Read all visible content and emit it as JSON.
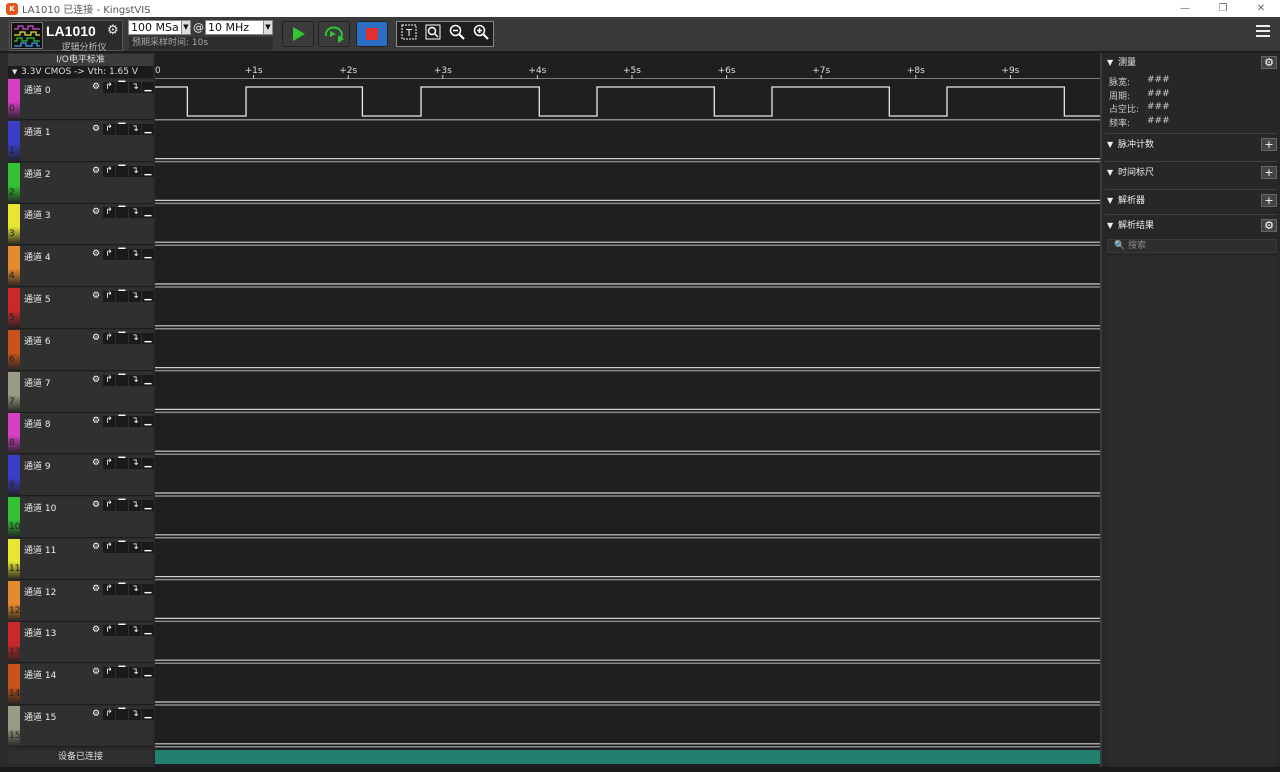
{
  "window": {
    "title": "LA1010 已连接 - KingstVIS",
    "minimize": "—",
    "restore": "❐",
    "close": "✕"
  },
  "toolbar": {
    "device_name": "LA1010",
    "device_subtitle": "逻辑分析仪",
    "sample_depth": "100 MSa",
    "at": "@",
    "sample_rate": "10 MHz",
    "estimated_time": "预期采样时间: 10s",
    "colors": {
      "run": "#3aa23a",
      "loop": "#3aa23a",
      "stop": "#2a6fc4",
      "stop_square": "#e23030"
    }
  },
  "left": {
    "io_label": "I/O电平标准",
    "io_standard": "3.3V CMOS -> Vth: 1.65 V",
    "status": "设备已连接",
    "channels": [
      {
        "name": "通道 0",
        "num": "0",
        "color": "#d43fc4"
      },
      {
        "name": "通道 1",
        "num": "1",
        "color": "#3a3fc8"
      },
      {
        "name": "通道 2",
        "num": "2",
        "color": "#33c233"
      },
      {
        "name": "通道 3",
        "num": "3",
        "color": "#e6e633"
      },
      {
        "name": "通道 4",
        "num": "4",
        "color": "#e68a2e"
      },
      {
        "name": "通道 5",
        "num": "5",
        "color": "#c82a2a"
      },
      {
        "name": "通道 6",
        "num": "6",
        "color": "#c8541a"
      },
      {
        "name": "通道 7",
        "num": "7",
        "color": "#9a9a86"
      },
      {
        "name": "通道 8",
        "num": "8",
        "color": "#d43fc4"
      },
      {
        "name": "通道 9",
        "num": "9",
        "color": "#3a3fc8"
      },
      {
        "name": "通道 10",
        "num": "10",
        "color": "#33c233"
      },
      {
        "name": "通道 11",
        "num": "11",
        "color": "#e6e633"
      },
      {
        "name": "通道 12",
        "num": "12",
        "color": "#e68a2e"
      },
      {
        "name": "通道 13",
        "num": "13",
        "color": "#c82a2a"
      },
      {
        "name": "通道 14",
        "num": "14",
        "color": "#c8541a"
      },
      {
        "name": "通道 15",
        "num": "15",
        "color": "#9a9a86"
      }
    ]
  },
  "timeline": {
    "start_label": "0",
    "ticks": [
      "+1s",
      "+2s",
      "+3s",
      "+4s",
      "+5s",
      "+6s",
      "+7s",
      "+8s",
      "+9s"
    ],
    "channel0_transitions_s": [
      0.3,
      0.92,
      2.15,
      2.77,
      4.02,
      4.63,
      5.87,
      6.48,
      7.72,
      8.33,
      9.57
    ],
    "initial_level": "high"
  },
  "right": {
    "measure": {
      "title": "测量",
      "rows": [
        {
          "label": "脉宽:",
          "value": "###"
        },
        {
          "label": "周期:",
          "value": "###"
        },
        {
          "label": "占空比:",
          "value": "###"
        },
        {
          "label": "频率:",
          "value": "###"
        }
      ]
    },
    "pulse_count": "脉冲计数",
    "time_ruler": "时间标尺",
    "analyzer": "解析器",
    "results": "解析结果",
    "search_placeholder": "搜索"
  }
}
